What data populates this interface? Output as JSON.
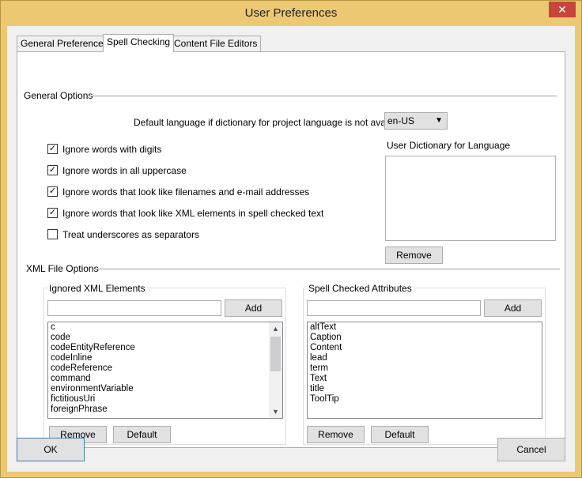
{
  "window": {
    "title": "User Preferences",
    "close_glyph": "✕"
  },
  "tabs": [
    {
      "label": "General Preferences"
    },
    {
      "label": "Spell Checking"
    },
    {
      "label": "Content File Editors"
    }
  ],
  "general_options": {
    "header": "General Options",
    "language_prompt": "Default language if dictionary for project language is not available",
    "language_value": "en-US",
    "checkboxes": [
      {
        "label": "Ignore words with digits",
        "checked": true
      },
      {
        "label": "Ignore words in all uppercase",
        "checked": true
      },
      {
        "label": "Ignore words that look like filenames and e-mail addresses",
        "checked": true
      },
      {
        "label": "Ignore words that look like XML elements in spell checked text",
        "checked": true
      },
      {
        "label": "Treat underscores as separators",
        "checked": false
      }
    ],
    "user_dictionary_label": "User Dictionary for Language",
    "remove_label": "Remove"
  },
  "xml_options": {
    "header": "XML File Options",
    "ignored": {
      "label": "Ignored XML Elements",
      "add_label": "Add",
      "items": [
        "c",
        "code",
        "codeEntityReference",
        "codeInline",
        "codeReference",
        "command",
        "environmentVariable",
        "fictitiousUri",
        "foreignPhrase"
      ],
      "remove_label": "Remove",
      "default_label": "Default"
    },
    "attributes": {
      "label": "Spell Checked Attributes",
      "add_label": "Add",
      "items": [
        "altText",
        "Caption",
        "Content",
        "lead",
        "term",
        "Text",
        "title",
        "ToolTip"
      ],
      "remove_label": "Remove",
      "default_label": "Default"
    }
  },
  "footer": {
    "ok_label": "OK",
    "cancel_label": "Cancel"
  }
}
